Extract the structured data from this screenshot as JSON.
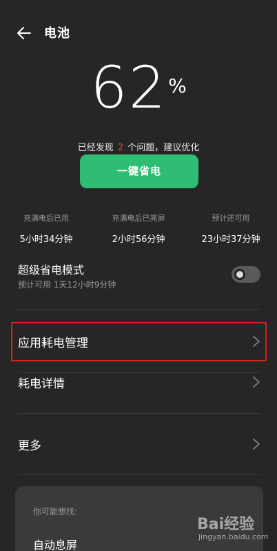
{
  "header": {
    "title": "电池",
    "back_icon": "arrow-left-icon"
  },
  "battery": {
    "percent": "62",
    "unit": "%",
    "issues_prefix": "已经发现",
    "issues_count": "2",
    "issues_suffix": "个问题，建议优化",
    "optimize_button": "一键省电",
    "accent_color": "#2ebd72",
    "alert_color": "#e14a3c"
  },
  "stats": [
    {
      "label": "充满电后已用",
      "value": "5小时34分钟"
    },
    {
      "label": "充满电后已亮屏",
      "value": "2小时56分钟"
    },
    {
      "label": "预计还可用",
      "value": "23小时37分钟"
    }
  ],
  "super_mode": {
    "title": "超级省电模式",
    "subtitle": "预计可用 1天12小时9分钟",
    "enabled": false
  },
  "menu": [
    {
      "label": "应用耗电管理",
      "highlighted": true
    },
    {
      "label": "耗电详情",
      "highlighted": false
    },
    {
      "label": "更多",
      "highlighted": false
    }
  ],
  "suggestions": {
    "heading": "你可能想找:",
    "items": [
      "自动息屏"
    ]
  },
  "watermark": {
    "main": "Bai经验",
    "sub": "jingyan.baidu.com"
  }
}
